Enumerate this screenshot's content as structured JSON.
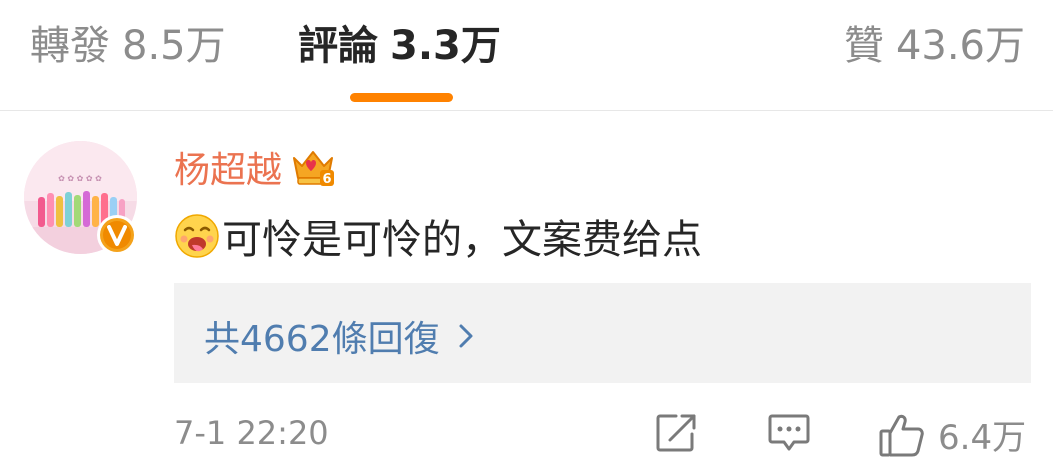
{
  "tabs": {
    "repost": {
      "label": "轉發",
      "count": "8.5万"
    },
    "comments": {
      "label": "評論",
      "count": "3.3万"
    },
    "likes": {
      "label": "贊",
      "count": "43.6万"
    }
  },
  "colors": {
    "accent": "#ff8200",
    "username": "#eb7350",
    "link": "#507daf",
    "muted": "#8c8c8c"
  },
  "comment": {
    "username": "杨超越",
    "emoji": "greedy-face-emoji",
    "text": "可怜是可怜的，文案费给点",
    "replies_label": "共4662條回復",
    "timestamp": "7-1 22:20",
    "like_count": "6.4万"
  },
  "icons": {
    "avatar_badge": "verified-v-badge",
    "crown": "member-crown-level-6",
    "share": "share-icon",
    "reply": "comment-icon",
    "like": "thumbs-up-icon"
  }
}
